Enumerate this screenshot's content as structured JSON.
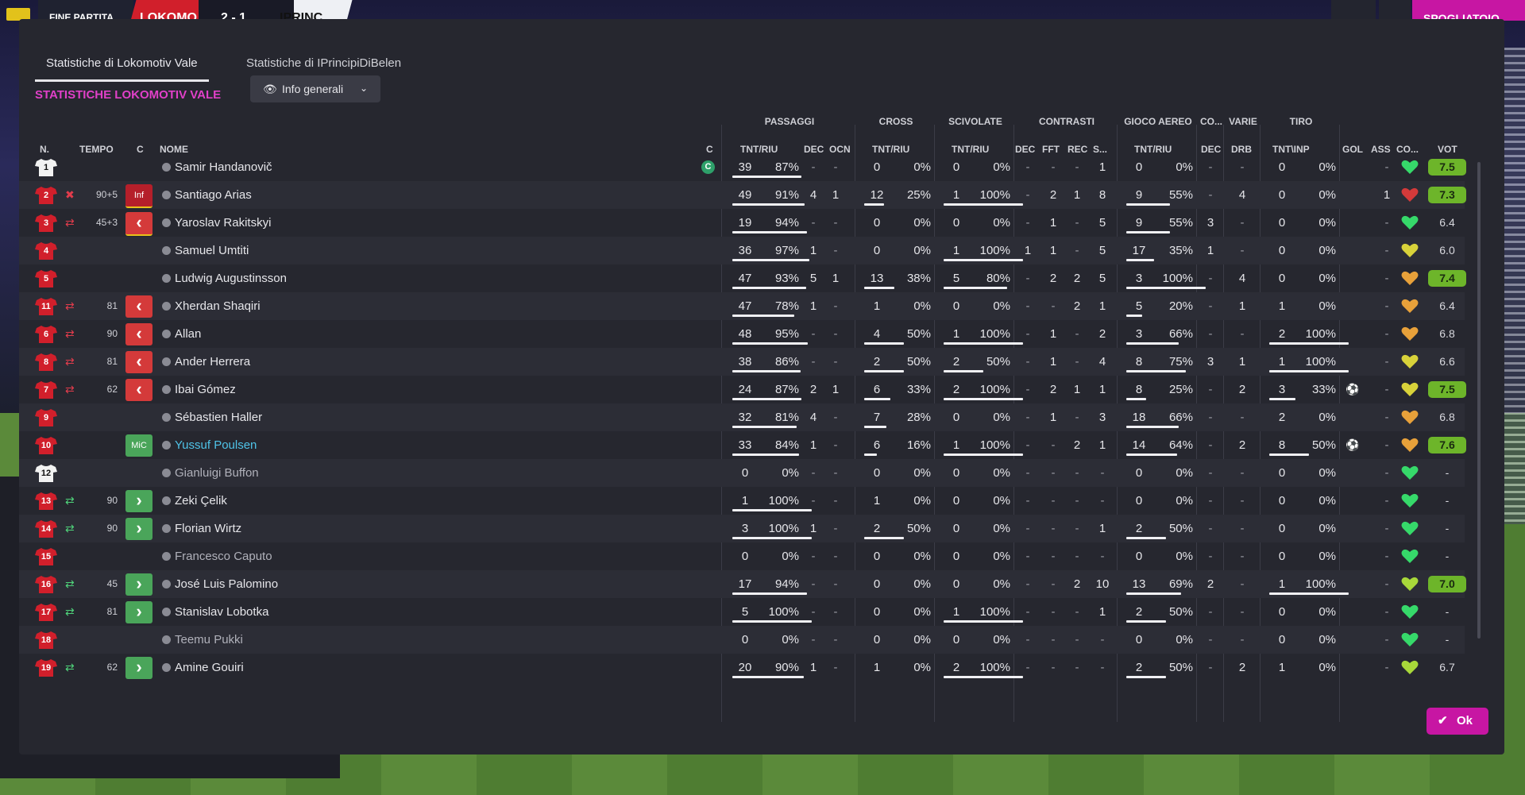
{
  "topbar": {
    "status": "FINE PARTITA",
    "home": "LOKOMO",
    "score": "2 - 1",
    "away": "IPRINC",
    "dressing_room": "SPOGLIATOIO",
    "ctrl": "1 2"
  },
  "tabs": [
    {
      "label": "Statistiche di Lokomotiv Vale"
    },
    {
      "label": "Statistiche di IPrincipiDiBelen"
    }
  ],
  "section_title": "STATISTICHE LOKOMOTIV VALE",
  "view_dropdown": {
    "label": "Info generali",
    "icon": "eye-icon"
  },
  "group_headers": {
    "passaggi": "PASSAGGI",
    "cross": "CROSS",
    "scivolate": "SCIVOLATE",
    "contrasti": "CONTRASTI",
    "gioco_aereo": "GIOCO AEREO",
    "co": "CO...",
    "varie": "VARIE",
    "tiro": "TIRO"
  },
  "columns": {
    "n": "N.",
    "tempo": "TEMPO",
    "c": "C",
    "nome": "NOME",
    "cap": "C",
    "pass_tnt": "TNT/RIU",
    "pass_dec": "DEC",
    "pass_ocn": "OCN",
    "cross_tnt": "TNT/RIU",
    "sciv_tnt": "TNT/RIU",
    "con_dec": "DEC",
    "con_fft": "FFT",
    "con_rec": "REC",
    "con_s": "S...",
    "aereo_tnt": "TNT/RIU",
    "co_dec": "DEC",
    "varie_drb": "DRB",
    "tiro_tnt": "TNT\\INP",
    "gol": "GOL",
    "ass": "ASS",
    "condition": "CO...",
    "vot": "VOT"
  },
  "players": [
    {
      "n": "1",
      "time": "",
      "badge": "",
      "name": "Samir Handanovič",
      "captain": "C",
      "pass": "39",
      "pass_pct": "87%",
      "pdec": "-",
      "pocn": "-",
      "cross": "0",
      "cross_pct": "0%",
      "sciv": "0",
      "sciv_pct": "0%",
      "cdec": "-",
      "cfft": "-",
      "crec": "-",
      "cs": "1",
      "aer": "0",
      "aer_pct": "0%",
      "codec": "-",
      "drb": "-",
      "tiro": "0",
      "tiro_pct": "0%",
      "gol": "",
      "ass": "-",
      "vot": "7.5",
      "vgood": true,
      "heart": "#36d96a",
      "pass_f": 0.87,
      "cross_f": 0,
      "sciv_f": 0,
      "aer_f": 0,
      "tiro_f": 0
    },
    {
      "n": "2",
      "time": "90+5",
      "badge": "Inf",
      "name": "Santiago Arias",
      "pass": "49",
      "pass_pct": "91%",
      "pdec": "4",
      "pocn": "1",
      "cross": "12",
      "cross_pct": "25%",
      "sciv": "1",
      "sciv_pct": "100%",
      "cdec": "-",
      "cfft": "2",
      "crec": "1",
      "cs": "8",
      "aer": "9",
      "aer_pct": "55%",
      "codec": "-",
      "drb": "4",
      "tiro": "0",
      "tiro_pct": "0%",
      "gol": "",
      "ass": "1",
      "vot": "7.3",
      "vgood": true,
      "heart": "#d43a3a",
      "pass_f": 0.91,
      "cross_f": 0.25,
      "sciv_f": 1,
      "aer_f": 0.55,
      "tiro_f": 0
    },
    {
      "n": "3",
      "time": "45+3",
      "badge": "<",
      "name": "Yaroslav Rakitskyi",
      "pass": "19",
      "pass_pct": "94%",
      "pdec": "-",
      "pocn": "-",
      "cross": "0",
      "cross_pct": "0%",
      "sciv": "0",
      "sciv_pct": "0%",
      "cdec": "-",
      "cfft": "1",
      "crec": "-",
      "cs": "5",
      "aer": "9",
      "aer_pct": "55%",
      "codec": "3",
      "drb": "-",
      "tiro": "0",
      "tiro_pct": "0%",
      "gol": "",
      "ass": "-",
      "vot": "6.4",
      "vgood": false,
      "heart": "#36d96a",
      "pass_f": 0.94,
      "cross_f": 0,
      "sciv_f": 0,
      "aer_f": 0.55,
      "tiro_f": 0
    },
    {
      "n": "4",
      "time": "",
      "badge": "",
      "name": "Samuel Umtiti",
      "pass": "36",
      "pass_pct": "97%",
      "pdec": "1",
      "pocn": "-",
      "cross": "0",
      "cross_pct": "0%",
      "sciv": "1",
      "sciv_pct": "100%",
      "cdec": "1",
      "cfft": "1",
      "crec": "-",
      "cs": "5",
      "aer": "17",
      "aer_pct": "35%",
      "codec": "1",
      "drb": "-",
      "tiro": "0",
      "tiro_pct": "0%",
      "gol": "",
      "ass": "-",
      "vot": "6.0",
      "vgood": false,
      "heart": "#d8d23a",
      "pass_f": 0.97,
      "cross_f": 0,
      "sciv_f": 1,
      "aer_f": 0.35,
      "tiro_f": 0
    },
    {
      "n": "5",
      "time": "",
      "badge": "",
      "name": "Ludwig Augustinsson",
      "pass": "47",
      "pass_pct": "93%",
      "pdec": "5",
      "pocn": "1",
      "cross": "13",
      "cross_pct": "38%",
      "sciv": "5",
      "sciv_pct": "80%",
      "cdec": "-",
      "cfft": "2",
      "crec": "2",
      "cs": "5",
      "aer": "3",
      "aer_pct": "100%",
      "codec": "-",
      "drb": "4",
      "tiro": "0",
      "tiro_pct": "0%",
      "gol": "",
      "ass": "-",
      "vot": "7.4",
      "vgood": true,
      "heart": "#e8a13a",
      "pass_f": 0.93,
      "cross_f": 0.38,
      "sciv_f": 0.8,
      "aer_f": 1,
      "tiro_f": 0
    },
    {
      "n": "11",
      "time": "81",
      "badge": "<",
      "name": "Xherdan Shaqiri",
      "pass": "47",
      "pass_pct": "78%",
      "pdec": "1",
      "pocn": "-",
      "cross": "1",
      "cross_pct": "0%",
      "sciv": "0",
      "sciv_pct": "0%",
      "cdec": "-",
      "cfft": "-",
      "crec": "2",
      "cs": "1",
      "aer": "5",
      "aer_pct": "20%",
      "codec": "-",
      "drb": "1",
      "tiro": "1",
      "tiro_pct": "0%",
      "gol": "",
      "ass": "-",
      "vot": "6.4",
      "vgood": false,
      "heart": "#e8a13a",
      "pass_f": 0.78,
      "cross_f": 0,
      "sciv_f": 0,
      "aer_f": 0.2,
      "tiro_f": 0
    },
    {
      "n": "6",
      "time": "90",
      "badge": "<",
      "name": "Allan",
      "pass": "48",
      "pass_pct": "95%",
      "pdec": "-",
      "pocn": "-",
      "cross": "4",
      "cross_pct": "50%",
      "sciv": "1",
      "sciv_pct": "100%",
      "cdec": "-",
      "cfft": "1",
      "crec": "-",
      "cs": "2",
      "aer": "3",
      "aer_pct": "66%",
      "codec": "-",
      "drb": "-",
      "tiro": "2",
      "tiro_pct": "100%",
      "gol": "",
      "ass": "-",
      "vot": "6.8",
      "vgood": false,
      "heart": "#e8a13a",
      "pass_f": 0.95,
      "cross_f": 0.5,
      "sciv_f": 1,
      "aer_f": 0.66,
      "tiro_f": 1
    },
    {
      "n": "8",
      "time": "81",
      "badge": "<",
      "name": "Ander Herrera",
      "pass": "38",
      "pass_pct": "86%",
      "pdec": "-",
      "pocn": "-",
      "cross": "2",
      "cross_pct": "50%",
      "sciv": "2",
      "sciv_pct": "50%",
      "cdec": "-",
      "cfft": "1",
      "crec": "-",
      "cs": "4",
      "aer": "8",
      "aer_pct": "75%",
      "codec": "3",
      "drb": "1",
      "tiro": "1",
      "tiro_pct": "100%",
      "gol": "",
      "ass": "-",
      "vot": "6.6",
      "vgood": false,
      "heart": "#d8d23a",
      "pass_f": 0.86,
      "cross_f": 0.5,
      "sciv_f": 0.5,
      "aer_f": 0.75,
      "tiro_f": 1
    },
    {
      "n": "7",
      "time": "62",
      "badge": "<",
      "name": "Ibai Gómez",
      "pass": "24",
      "pass_pct": "87%",
      "pdec": "2",
      "pocn": "1",
      "cross": "6",
      "cross_pct": "33%",
      "sciv": "2",
      "sciv_pct": "100%",
      "cdec": "-",
      "cfft": "2",
      "crec": "1",
      "cs": "1",
      "aer": "8",
      "aer_pct": "25%",
      "codec": "-",
      "drb": "2",
      "tiro": "3",
      "tiro_pct": "33%",
      "gol": "ball",
      "ass": "-",
      "vot": "7.5",
      "vgood": true,
      "heart": "#d8d23a",
      "pass_f": 0.87,
      "cross_f": 0.33,
      "sciv_f": 1,
      "aer_f": 0.25,
      "tiro_f": 0.33
    },
    {
      "n": "9",
      "time": "",
      "badge": "",
      "name": "Sébastien Haller",
      "pass": "32",
      "pass_pct": "81%",
      "pdec": "4",
      "pocn": "-",
      "cross": "7",
      "cross_pct": "28%",
      "sciv": "0",
      "sciv_pct": "0%",
      "cdec": "-",
      "cfft": "1",
      "crec": "-",
      "cs": "3",
      "aer": "18",
      "aer_pct": "66%",
      "codec": "-",
      "drb": "-",
      "tiro": "2",
      "tiro_pct": "0%",
      "gol": "",
      "ass": "-",
      "vot": "6.8",
      "vgood": false,
      "heart": "#e8a13a",
      "pass_f": 0.81,
      "cross_f": 0.28,
      "sciv_f": 0,
      "aer_f": 0.66,
      "tiro_f": 0
    },
    {
      "n": "10",
      "time": "",
      "badge": "MiC",
      "name": "Yussuf Poulsen",
      "link": true,
      "pass": "33",
      "pass_pct": "84%",
      "pdec": "1",
      "pocn": "-",
      "cross": "6",
      "cross_pct": "16%",
      "sciv": "1",
      "sciv_pct": "100%",
      "cdec": "-",
      "cfft": "-",
      "crec": "2",
      "cs": "1",
      "aer": "14",
      "aer_pct": "64%",
      "codec": "-",
      "drb": "2",
      "tiro": "8",
      "tiro_pct": "50%",
      "gol": "ball",
      "ass": "-",
      "vot": "7.6",
      "vgood": true,
      "heart": "#e8a13a",
      "pass_f": 0.84,
      "cross_f": 0.16,
      "sciv_f": 1,
      "aer_f": 0.64,
      "tiro_f": 0.5
    },
    {
      "n": "12",
      "time": "",
      "badge": "",
      "name": "Gianluigi Buffon",
      "dim": true,
      "pass": "0",
      "pass_pct": "0%",
      "pdec": "-",
      "pocn": "-",
      "cross": "0",
      "cross_pct": "0%",
      "sciv": "0",
      "sciv_pct": "0%",
      "cdec": "-",
      "cfft": "-",
      "crec": "-",
      "cs": "-",
      "aer": "0",
      "aer_pct": "0%",
      "codec": "-",
      "drb": "-",
      "tiro": "0",
      "tiro_pct": "0%",
      "gol": "",
      "ass": "-",
      "vot": "-",
      "vgood": false,
      "heart": "#36d96a",
      "pass_f": 0,
      "cross_f": 0,
      "sciv_f": 0,
      "aer_f": 0,
      "tiro_f": 0
    },
    {
      "n": "13",
      "time": "90",
      "badge": ">",
      "name": "Zeki Çelik",
      "pass": "1",
      "pass_pct": "100%",
      "pdec": "-",
      "pocn": "-",
      "cross": "1",
      "cross_pct": "0%",
      "sciv": "0",
      "sciv_pct": "0%",
      "cdec": "-",
      "cfft": "-",
      "crec": "-",
      "cs": "-",
      "aer": "0",
      "aer_pct": "0%",
      "codec": "-",
      "drb": "-",
      "tiro": "0",
      "tiro_pct": "0%",
      "gol": "",
      "ass": "-",
      "vot": "-",
      "vgood": false,
      "heart": "#36d96a",
      "pass_f": 1,
      "cross_f": 0,
      "sciv_f": 0,
      "aer_f": 0,
      "tiro_f": 0
    },
    {
      "n": "14",
      "time": "90",
      "badge": ">",
      "name": "Florian Wirtz",
      "pass": "3",
      "pass_pct": "100%",
      "pdec": "1",
      "pocn": "-",
      "cross": "2",
      "cross_pct": "50%",
      "sciv": "0",
      "sciv_pct": "0%",
      "cdec": "-",
      "cfft": "-",
      "crec": "-",
      "cs": "1",
      "aer": "2",
      "aer_pct": "50%",
      "codec": "-",
      "drb": "-",
      "tiro": "0",
      "tiro_pct": "0%",
      "gol": "",
      "ass": "-",
      "vot": "-",
      "vgood": false,
      "heart": "#36d96a",
      "pass_f": 1,
      "cross_f": 0.5,
      "sciv_f": 0,
      "aer_f": 0.5,
      "tiro_f": 0
    },
    {
      "n": "15",
      "time": "",
      "badge": "",
      "name": "Francesco Caputo",
      "dim": true,
      "pass": "0",
      "pass_pct": "0%",
      "pdec": "-",
      "pocn": "-",
      "cross": "0",
      "cross_pct": "0%",
      "sciv": "0",
      "sciv_pct": "0%",
      "cdec": "-",
      "cfft": "-",
      "crec": "-",
      "cs": "-",
      "aer": "0",
      "aer_pct": "0%",
      "codec": "-",
      "drb": "-",
      "tiro": "0",
      "tiro_pct": "0%",
      "gol": "",
      "ass": "-",
      "vot": "-",
      "vgood": false,
      "heart": "#36d96a",
      "pass_f": 0,
      "cross_f": 0,
      "sciv_f": 0,
      "aer_f": 0,
      "tiro_f": 0
    },
    {
      "n": "16",
      "time": "45",
      "badge": ">",
      "name": "José Luis Palomino",
      "pass": "17",
      "pass_pct": "94%",
      "pdec": "-",
      "pocn": "-",
      "cross": "0",
      "cross_pct": "0%",
      "sciv": "0",
      "sciv_pct": "0%",
      "cdec": "-",
      "cfft": "-",
      "crec": "2",
      "cs": "10",
      "aer": "13",
      "aer_pct": "69%",
      "codec": "2",
      "drb": "-",
      "tiro": "1",
      "tiro_pct": "100%",
      "gol": "",
      "ass": "-",
      "vot": "7.0",
      "vgood": true,
      "heart": "#a8d83a",
      "pass_f": 0.94,
      "cross_f": 0,
      "sciv_f": 0,
      "aer_f": 0.69,
      "tiro_f": 1
    },
    {
      "n": "17",
      "time": "81",
      "badge": ">",
      "name": "Stanislav Lobotka",
      "pass": "5",
      "pass_pct": "100%",
      "pdec": "-",
      "pocn": "-",
      "cross": "0",
      "cross_pct": "0%",
      "sciv": "1",
      "sciv_pct": "100%",
      "cdec": "-",
      "cfft": "-",
      "crec": "-",
      "cs": "1",
      "aer": "2",
      "aer_pct": "50%",
      "codec": "-",
      "drb": "-",
      "tiro": "0",
      "tiro_pct": "0%",
      "gol": "",
      "ass": "-",
      "vot": "-",
      "vgood": false,
      "heart": "#36d96a",
      "pass_f": 1,
      "cross_f": 0,
      "sciv_f": 1,
      "aer_f": 0.5,
      "tiro_f": 0
    },
    {
      "n": "18",
      "time": "",
      "badge": "",
      "name": "Teemu Pukki",
      "dim": true,
      "pass": "0",
      "pass_pct": "0%",
      "pdec": "-",
      "pocn": "-",
      "cross": "0",
      "cross_pct": "0%",
      "sciv": "0",
      "sciv_pct": "0%",
      "cdec": "-",
      "cfft": "-",
      "crec": "-",
      "cs": "-",
      "aer": "0",
      "aer_pct": "0%",
      "codec": "-",
      "drb": "-",
      "tiro": "0",
      "tiro_pct": "0%",
      "gol": "",
      "ass": "-",
      "vot": "-",
      "vgood": false,
      "heart": "#36d96a",
      "pass_f": 0,
      "cross_f": 0,
      "sciv_f": 0,
      "aer_f": 0,
      "tiro_f": 0
    },
    {
      "n": "19",
      "time": "62",
      "badge": ">",
      "name": "Amine Gouiri",
      "pass": "20",
      "pass_pct": "90%",
      "pdec": "1",
      "pocn": "-",
      "cross": "1",
      "cross_pct": "0%",
      "sciv": "2",
      "sciv_pct": "100%",
      "cdec": "-",
      "cfft": "-",
      "crec": "-",
      "cs": "-",
      "aer": "2",
      "aer_pct": "50%",
      "codec": "-",
      "drb": "2",
      "tiro": "1",
      "tiro_pct": "0%",
      "gol": "",
      "ass": "-",
      "vot": "6.7",
      "vgood": false,
      "heart": "#a8d83a",
      "pass_f": 0.9,
      "cross_f": 0,
      "sciv_f": 1,
      "aer_f": 0.5,
      "tiro_f": 0
    }
  ],
  "ok_button": "Ok"
}
